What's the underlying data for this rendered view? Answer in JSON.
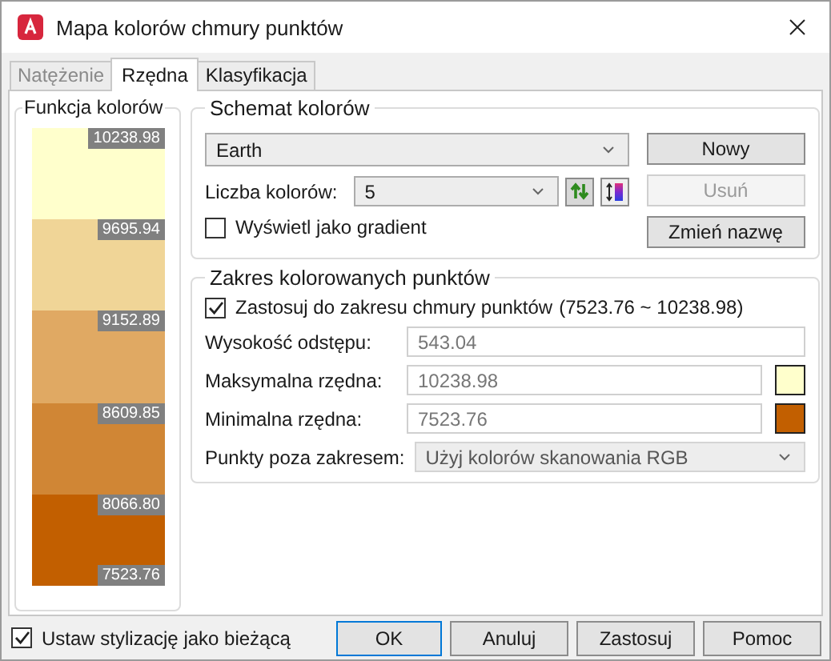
{
  "window": {
    "title": "Mapa kolorów chmury punktów"
  },
  "tabs": [
    {
      "label": "Natężenie",
      "selected": false,
      "disabled": true
    },
    {
      "label": "Rzędna",
      "selected": true,
      "disabled": false
    },
    {
      "label": "Klasyfikacja",
      "selected": false,
      "disabled": false
    }
  ],
  "color_function": {
    "title": "Funkcja kolorów",
    "bands": [
      {
        "color": "#ffffcc",
        "label": "10238.98"
      },
      {
        "color": "#f0d597",
        "label": "9695.94"
      },
      {
        "color": "#e0a963",
        "label": "9152.89"
      },
      {
        "color": "#d08635",
        "label": "8609.85"
      },
      {
        "color": "#c25f00",
        "label": "8066.80"
      }
    ],
    "bottom_label": "7523.76"
  },
  "color_scheme": {
    "title": "Schemat kolorów",
    "scheme": "Earth",
    "count_label": "Liczba kolorów:",
    "count": "5",
    "gradient": {
      "label": "Wyświetl jako gradient",
      "checked": false
    },
    "buttons": [
      {
        "label": "Nowy",
        "disabled": false
      },
      {
        "label": "Usuń",
        "disabled": true
      },
      {
        "label": "Zmień nazwę",
        "disabled": false
      }
    ]
  },
  "range": {
    "title": "Zakres kolorowanych punktów",
    "apply": {
      "label": "Zastosuj do zakresu chmury punktów",
      "range": "(7523.76 ~ 10238.98)",
      "checked": true
    },
    "fields": [
      {
        "label": "Wysokość odstępu:",
        "value": "543.04"
      },
      {
        "label": "Maksymalna rzędna:",
        "value": "10238.98",
        "color": "#ffffcc"
      },
      {
        "label": "Minimalna rzędna:",
        "value": "7523.76",
        "color": "#c25f00"
      }
    ],
    "outside_label": "Punkty poza zakresem:",
    "outside_value": "Użyj kolorów skanowania RGB"
  },
  "footer": {
    "set_current": {
      "label": "Ustaw stylizację jako bieżącą",
      "checked": true
    },
    "buttons": [
      {
        "label": "OK",
        "default": true
      },
      {
        "label": "Anuluj",
        "default": false
      },
      {
        "label": "Zastosuj",
        "default": false
      },
      {
        "label": "Pomoc",
        "default": false
      }
    ]
  }
}
